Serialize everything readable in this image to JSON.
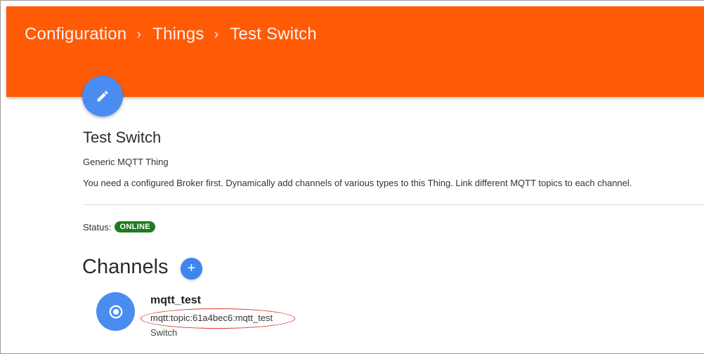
{
  "header": {
    "breadcrumb": [
      "Configuration",
      "Things",
      "Test Switch"
    ],
    "separator": "›",
    "background_color": "#ff5a06"
  },
  "thing": {
    "edit_icon": "pencil-icon",
    "title": "Test Switch",
    "type": "Generic MQTT Thing",
    "description": "You need a configured Broker first. Dynamically add channels of various types to this Thing. Link different MQTT topics to each channel.",
    "status_label": "Status:",
    "status_value": "ONLINE",
    "status_color": "#1e7b1e"
  },
  "channels": {
    "title": "Channels",
    "add_icon": "plus-icon",
    "add_label": "+",
    "items": [
      {
        "icon": "radio-button-icon",
        "name": "mqtt_test",
        "uid": "mqtt:topic:61a4bec6:mqtt_test",
        "type": "Switch"
      }
    ]
  },
  "accent_color": "#4a8cf0"
}
